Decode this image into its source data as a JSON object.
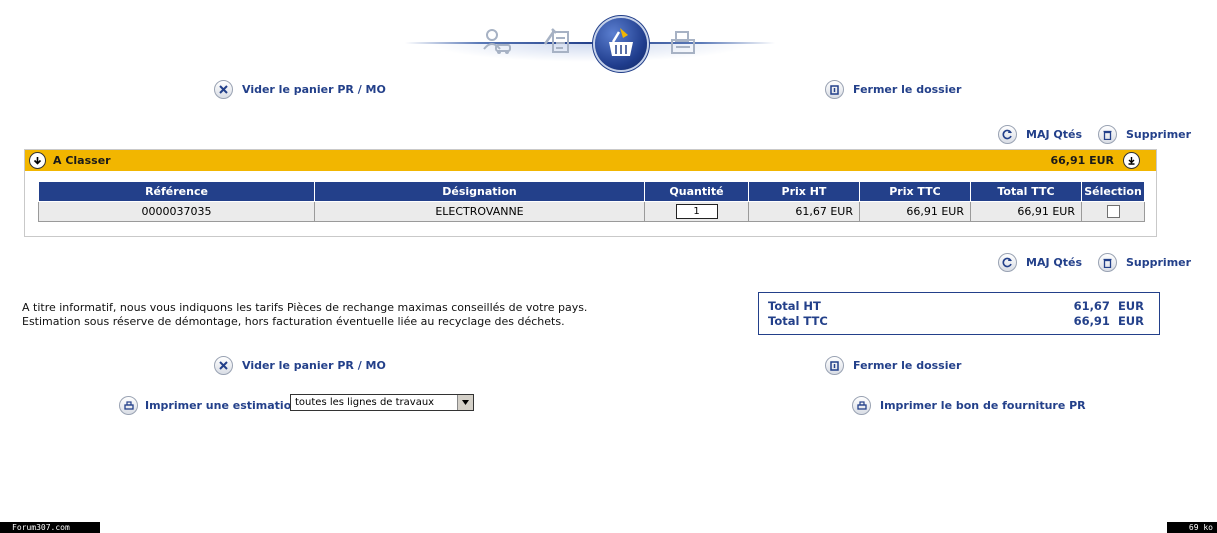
{
  "steps": {
    "icons": [
      "customer-vehicle-icon",
      "tools-checklist-icon",
      "basket-icon",
      "printer-document-icon"
    ],
    "active_index": 2
  },
  "top_actions": {
    "clear_cart": "Vider le panier PR / MO",
    "close_file": "Fermer le dossier"
  },
  "table_actions_top": {
    "update_qty": "MAJ Qtés",
    "delete": "Supprimer"
  },
  "section": {
    "label": "A Classer",
    "total": "66,91 EUR"
  },
  "table": {
    "columns": [
      "Référence",
      "Désignation",
      "Quantité",
      "Prix HT",
      "Prix TTC",
      "Total TTC",
      "Sélection"
    ],
    "rows": [
      {
        "reference": "0000037035",
        "designation": "ELECTROVANNE",
        "quantity": "1",
        "price_ht": "61,67 EUR",
        "price_ttc": "66,91 EUR",
        "total_ttc": "66,91 EUR",
        "selected": false
      }
    ]
  },
  "table_actions_bottom": {
    "update_qty": "MAJ Qtés",
    "delete": "Supprimer"
  },
  "info": {
    "line1": "A titre informatif, nous vous indiquons les tarifs Pièces de rechange maximas conseillés de votre pays.",
    "line2": "Estimation sous réserve de démontage, hors facturation éventuelle liée au recyclage des déchets."
  },
  "totals": {
    "ht_label": "Total HT",
    "ht_value": "61,67  EUR",
    "ttc_label": "Total TTC",
    "ttc_value": "66,91  EUR"
  },
  "bottom_actions": {
    "clear_cart": "Vider le panier PR / MO",
    "close_file": "Fermer le dossier",
    "print_estimate": "Imprimer une estimation",
    "print_estimate_select": "toutes les lignes de travaux",
    "print_supply": "Imprimer le bon de fourniture PR"
  },
  "footer": {
    "left": "Forum307.com",
    "right": "69 ko"
  },
  "colors": {
    "brand_blue": "#23408a",
    "header_yellow": "#f2b600",
    "row_grey": "#ebebeb"
  }
}
